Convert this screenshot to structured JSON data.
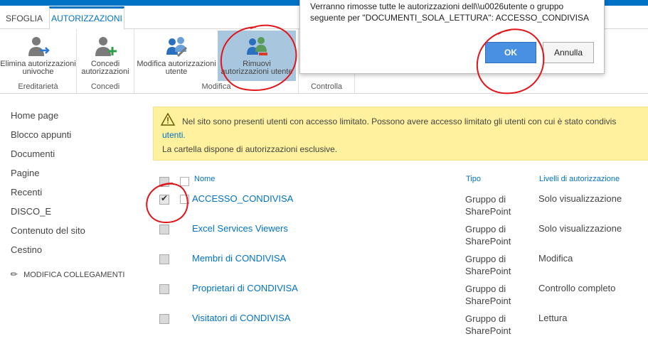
{
  "tabs": {
    "sfoglia": "SFOGLIA",
    "autorizzazioni": "AUTORIZZAZIONI"
  },
  "ribbon": {
    "groups": {
      "ereditarieta": "Ereditarietà",
      "concedi": "Concedi",
      "modifica": "Modifica",
      "controlla": "Controlla"
    },
    "buttons": {
      "elimina": "Elimina autorizzazioni univoche",
      "concedi": "Concedi autorizzazioni",
      "modifica": "Modifica autorizzazioni utente",
      "rimuovi": "Rimuovi autorizzazioni utente"
    }
  },
  "dialog": {
    "message": "Verranno rimosse tutte le autorizzazioni dell\\\\u0026utente o gruppo seguente per \"DOCUMENTI_SOLA_LETTURA\": ACCESSO_CONDIVISA",
    "ok": "OK",
    "cancel": "Annulla"
  },
  "nav": {
    "items": [
      "Home page",
      "Blocco appunti",
      "Documenti",
      "Pagine",
      "Recenti",
      "DISCO_E",
      "Contenuto del sito",
      "Cestino"
    ],
    "edit_links": "MODIFICA COLLEGAMENTI"
  },
  "warning": {
    "line1": "Nel sito sono presenti utenti con accesso limitato. Possono avere accesso limitato gli utenti con cui è stato condivis",
    "line2": "utenti.",
    "line3": "La cartella dispone di autorizzazioni esclusive."
  },
  "table": {
    "headers": {
      "name": "Nome",
      "type": "Tipo",
      "levels": "Livelli di autorizzazione"
    },
    "rows": [
      {
        "name": "ACCESSO_CONDIVISA",
        "type1": "Gruppo di",
        "type2": "SharePoint",
        "level": "Solo visualizzazione",
        "checked": true
      },
      {
        "name": "Excel Services Viewers",
        "type1": "Gruppo di",
        "type2": "SharePoint",
        "level": "Solo visualizzazione",
        "checked": false
      },
      {
        "name": "Membri di CONDIVISA",
        "type1": "Gruppo di",
        "type2": "SharePoint",
        "level": "Modifica",
        "checked": false
      },
      {
        "name": "Proprietari di CONDIVISA",
        "type1": "Gruppo di",
        "type2": "SharePoint",
        "level": "Controllo completo",
        "checked": false
      },
      {
        "name": "Visitatori di CONDIVISA",
        "type1": "Gruppo di",
        "type2": "SharePoint",
        "level": "Lettura",
        "checked": false
      }
    ]
  },
  "colors": {
    "accent": "#0072c6",
    "warning_bg": "#fff19d",
    "annotation": "#e0161b"
  }
}
